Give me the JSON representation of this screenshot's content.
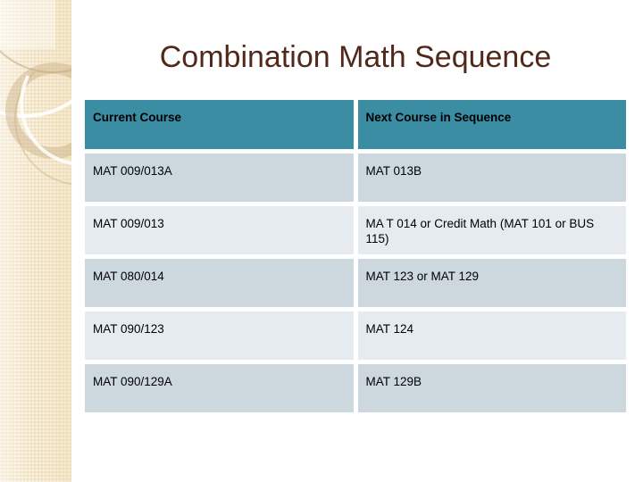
{
  "slide": {
    "title": "Combination Math Sequence",
    "title_color": "#51281a",
    "background_color": "#ffffff"
  },
  "decoration": {
    "sidebar_color": "#f4e5c4",
    "ring_color": "#c5aa7e",
    "arc_color": "#ffffff",
    "corner_tint": "#faf0da"
  },
  "table": {
    "header_background": "#3a8da2",
    "row_odd_background": "#ccd8de",
    "row_even_background": "#e6ebef",
    "gap_color": "#ffffff",
    "headers": [
      "Current Course",
      "Next Course in Sequence"
    ],
    "rows": [
      {
        "current": "MAT 009/013A",
        "next": "MAT 013B"
      },
      {
        "current": "MAT 009/013",
        "next": "MA T 014 or Credit Math (MAT 101 or BUS 115)"
      },
      {
        "current": "MAT 080/014",
        "next": "MAT 123 or MAT 129"
      },
      {
        "current": "MAT 090/123",
        "next": "MAT 124"
      },
      {
        "current": "MAT 090/129A",
        "next": "MAT 129B"
      }
    ]
  }
}
